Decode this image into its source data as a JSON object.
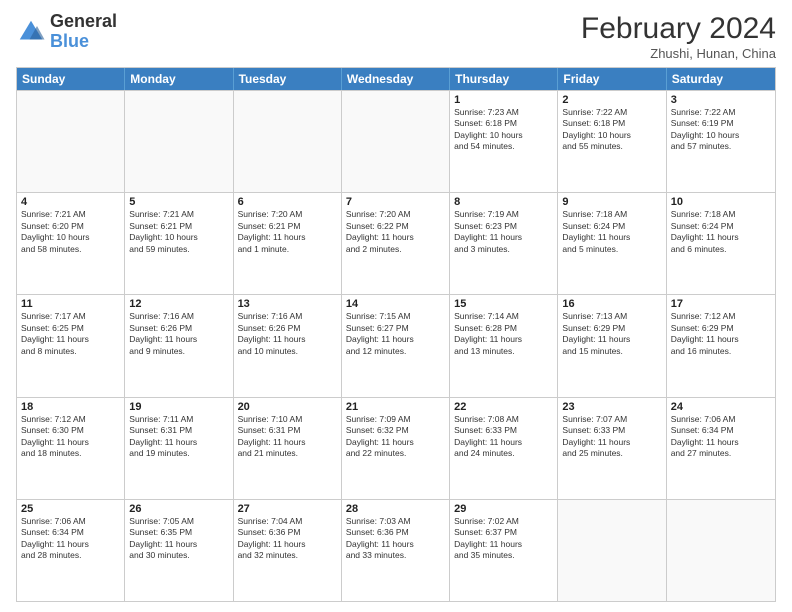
{
  "header": {
    "logo_general": "General",
    "logo_blue": "Blue",
    "month_year": "February 2024",
    "location": "Zhushi, Hunan, China"
  },
  "weekdays": [
    "Sunday",
    "Monday",
    "Tuesday",
    "Wednesday",
    "Thursday",
    "Friday",
    "Saturday"
  ],
  "rows": [
    [
      {
        "day": "",
        "info": ""
      },
      {
        "day": "",
        "info": ""
      },
      {
        "day": "",
        "info": ""
      },
      {
        "day": "",
        "info": ""
      },
      {
        "day": "1",
        "info": "Sunrise: 7:23 AM\nSunset: 6:18 PM\nDaylight: 10 hours\nand 54 minutes."
      },
      {
        "day": "2",
        "info": "Sunrise: 7:22 AM\nSunset: 6:18 PM\nDaylight: 10 hours\nand 55 minutes."
      },
      {
        "day": "3",
        "info": "Sunrise: 7:22 AM\nSunset: 6:19 PM\nDaylight: 10 hours\nand 57 minutes."
      }
    ],
    [
      {
        "day": "4",
        "info": "Sunrise: 7:21 AM\nSunset: 6:20 PM\nDaylight: 10 hours\nand 58 minutes."
      },
      {
        "day": "5",
        "info": "Sunrise: 7:21 AM\nSunset: 6:21 PM\nDaylight: 10 hours\nand 59 minutes."
      },
      {
        "day": "6",
        "info": "Sunrise: 7:20 AM\nSunset: 6:21 PM\nDaylight: 11 hours\nand 1 minute."
      },
      {
        "day": "7",
        "info": "Sunrise: 7:20 AM\nSunset: 6:22 PM\nDaylight: 11 hours\nand 2 minutes."
      },
      {
        "day": "8",
        "info": "Sunrise: 7:19 AM\nSunset: 6:23 PM\nDaylight: 11 hours\nand 3 minutes."
      },
      {
        "day": "9",
        "info": "Sunrise: 7:18 AM\nSunset: 6:24 PM\nDaylight: 11 hours\nand 5 minutes."
      },
      {
        "day": "10",
        "info": "Sunrise: 7:18 AM\nSunset: 6:24 PM\nDaylight: 11 hours\nand 6 minutes."
      }
    ],
    [
      {
        "day": "11",
        "info": "Sunrise: 7:17 AM\nSunset: 6:25 PM\nDaylight: 11 hours\nand 8 minutes."
      },
      {
        "day": "12",
        "info": "Sunrise: 7:16 AM\nSunset: 6:26 PM\nDaylight: 11 hours\nand 9 minutes."
      },
      {
        "day": "13",
        "info": "Sunrise: 7:16 AM\nSunset: 6:26 PM\nDaylight: 11 hours\nand 10 minutes."
      },
      {
        "day": "14",
        "info": "Sunrise: 7:15 AM\nSunset: 6:27 PM\nDaylight: 11 hours\nand 12 minutes."
      },
      {
        "day": "15",
        "info": "Sunrise: 7:14 AM\nSunset: 6:28 PM\nDaylight: 11 hours\nand 13 minutes."
      },
      {
        "day": "16",
        "info": "Sunrise: 7:13 AM\nSunset: 6:29 PM\nDaylight: 11 hours\nand 15 minutes."
      },
      {
        "day": "17",
        "info": "Sunrise: 7:12 AM\nSunset: 6:29 PM\nDaylight: 11 hours\nand 16 minutes."
      }
    ],
    [
      {
        "day": "18",
        "info": "Sunrise: 7:12 AM\nSunset: 6:30 PM\nDaylight: 11 hours\nand 18 minutes."
      },
      {
        "day": "19",
        "info": "Sunrise: 7:11 AM\nSunset: 6:31 PM\nDaylight: 11 hours\nand 19 minutes."
      },
      {
        "day": "20",
        "info": "Sunrise: 7:10 AM\nSunset: 6:31 PM\nDaylight: 11 hours\nand 21 minutes."
      },
      {
        "day": "21",
        "info": "Sunrise: 7:09 AM\nSunset: 6:32 PM\nDaylight: 11 hours\nand 22 minutes."
      },
      {
        "day": "22",
        "info": "Sunrise: 7:08 AM\nSunset: 6:33 PM\nDaylight: 11 hours\nand 24 minutes."
      },
      {
        "day": "23",
        "info": "Sunrise: 7:07 AM\nSunset: 6:33 PM\nDaylight: 11 hours\nand 25 minutes."
      },
      {
        "day": "24",
        "info": "Sunrise: 7:06 AM\nSunset: 6:34 PM\nDaylight: 11 hours\nand 27 minutes."
      }
    ],
    [
      {
        "day": "25",
        "info": "Sunrise: 7:06 AM\nSunset: 6:34 PM\nDaylight: 11 hours\nand 28 minutes."
      },
      {
        "day": "26",
        "info": "Sunrise: 7:05 AM\nSunset: 6:35 PM\nDaylight: 11 hours\nand 30 minutes."
      },
      {
        "day": "27",
        "info": "Sunrise: 7:04 AM\nSunset: 6:36 PM\nDaylight: 11 hours\nand 32 minutes."
      },
      {
        "day": "28",
        "info": "Sunrise: 7:03 AM\nSunset: 6:36 PM\nDaylight: 11 hours\nand 33 minutes."
      },
      {
        "day": "29",
        "info": "Sunrise: 7:02 AM\nSunset: 6:37 PM\nDaylight: 11 hours\nand 35 minutes."
      },
      {
        "day": "",
        "info": ""
      },
      {
        "day": "",
        "info": ""
      }
    ]
  ]
}
